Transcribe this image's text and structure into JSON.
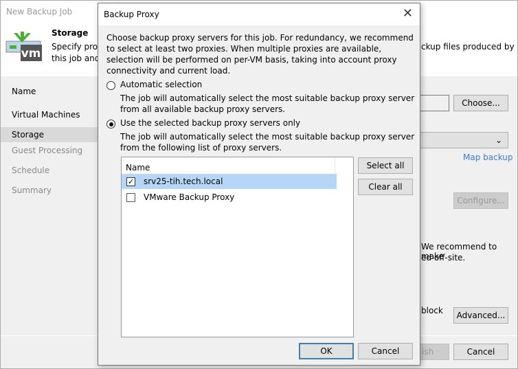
{
  "window": {
    "title": "New Backup Job",
    "step_title": "Storage",
    "step_desc": "Specify proce",
    "step_desc2": "this job and c",
    "desc_right": "ckup files produced by"
  },
  "nav": [
    {
      "label": "Name"
    },
    {
      "label": "Virtual Machines"
    },
    {
      "label": "Storage"
    },
    {
      "label": "Guest Processing"
    },
    {
      "label": "Schedule"
    },
    {
      "label": "Summary"
    }
  ],
  "bg": {
    "choose": "Choose...",
    "map_backup": "Map backup",
    "configure": "Configure...",
    "recommend1": "We recommend to make",
    "recommend2": "ed off-site.",
    "block": "block",
    "advanced": "Advanced...",
    "finish": "ish",
    "cancel": "Cancel"
  },
  "dialog": {
    "title": "Backup Proxy",
    "intro": "Choose backup proxy servers for this job. For redundancy, we recommend to select at least two proxies. When multiple proxies are available, selection will be performed on per-VM basis, taking into account proxy connectivity and current load.",
    "auto_label": "Automatic selection",
    "auto_desc": "The job will automatically select the most suitable backup proxy server from all available backup proxy servers.",
    "sel_label": "Use the selected backup proxy servers only",
    "sel_desc": "The job will automatically select the most suitable backup proxy server from the following list of proxy servers.",
    "col_name": "Name",
    "proxies": [
      {
        "name": "srv25-tih.tech.local",
        "checked": true
      },
      {
        "name": "VMware Backup Proxy",
        "checked": false
      }
    ],
    "select_all": "Select all",
    "clear_all": "Clear all",
    "ok": "OK",
    "cancel": "Cancel"
  }
}
